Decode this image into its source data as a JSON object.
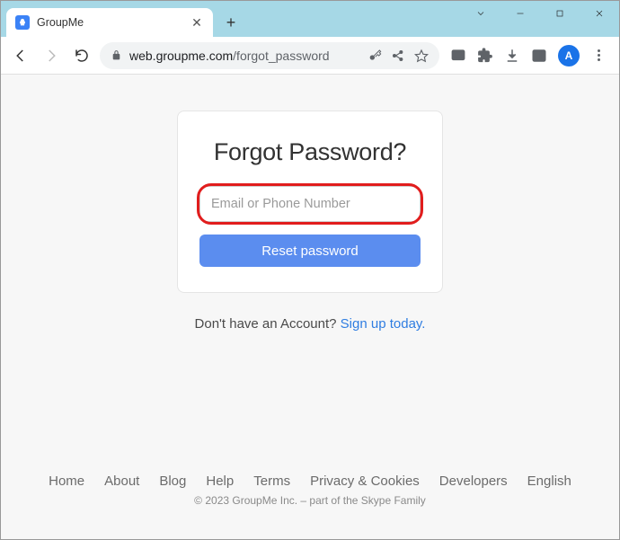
{
  "window": {
    "tab_title": "GroupMe",
    "avatar_initial": "A"
  },
  "url": {
    "host": "web.groupme.com",
    "path": "/forgot_password"
  },
  "page": {
    "heading": "Forgot Password?",
    "input_placeholder": "Email or Phone Number",
    "reset_button": "Reset password",
    "signup_prompt": "Don't have an Account? ",
    "signup_link": "Sign up today."
  },
  "footer": {
    "links": [
      "Home",
      "About",
      "Blog",
      "Help",
      "Terms",
      "Privacy & Cookies",
      "Developers",
      "English"
    ],
    "copyright": "© 2023 GroupMe Inc. – part of the Skype Family"
  }
}
